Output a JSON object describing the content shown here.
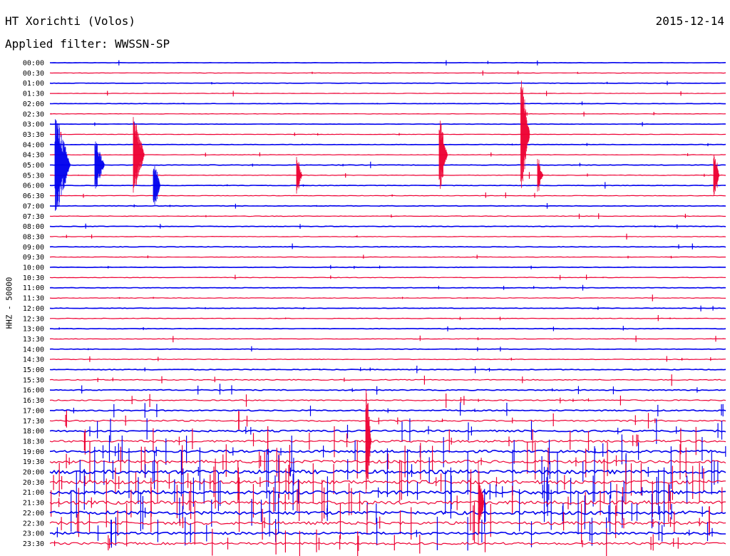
{
  "chart_data": {
    "type": "line",
    "title": "HT Xorichti (Volos)",
    "date": "2015-12-14",
    "filter_label": "Applied filter: WWSSN-SP",
    "ylabel": "HHZ - 50000",
    "row_labels": [
      "00:00",
      "00:30",
      "01:00",
      "01:30",
      "02:00",
      "02:30",
      "03:00",
      "03:30",
      "04:00",
      "04:30",
      "05:00",
      "05:30",
      "06:00",
      "06:30",
      "07:00",
      "07:30",
      "08:00",
      "08:30",
      "09:00",
      "09:30",
      "10:00",
      "10:30",
      "11:00",
      "11:30",
      "12:00",
      "12:30",
      "13:00",
      "13:30",
      "14:00",
      "14:30",
      "15:00",
      "15:30",
      "16:00",
      "16:30",
      "17:00",
      "17:30",
      "18:00",
      "18:30",
      "19:00",
      "19:30",
      "20:00",
      "20:30",
      "21:00",
      "21:30",
      "22:00",
      "22:30",
      "23:00",
      "23:30"
    ],
    "colors": {
      "even": "#0000ee",
      "odd": "#ee0033"
    },
    "noise_level": [
      0.3,
      0.3,
      0.3,
      0.3,
      0.3,
      0.3,
      0.3,
      0.3,
      0.3,
      0.3,
      0.4,
      0.4,
      0.4,
      0.4,
      0.4,
      0.4,
      0.4,
      0.4,
      0.4,
      0.4,
      0.4,
      0.4,
      0.4,
      0.4,
      0.4,
      0.4,
      0.4,
      0.4,
      0.4,
      0.5,
      0.6,
      0.7,
      0.8,
      0.9,
      1.0,
      1.2,
      1.5,
      1.8,
      2.0,
      2.5,
      3.0,
      3.0,
      3.0,
      3.0,
      2.8,
      2.5,
      2.0,
      1.8
    ]
  }
}
